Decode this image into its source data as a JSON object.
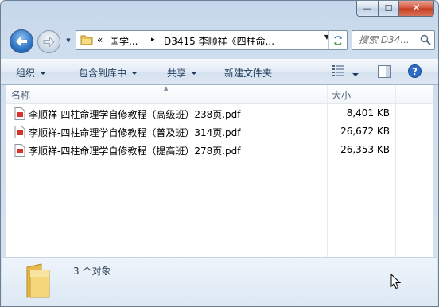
{
  "window": {
    "caption_buttons": {
      "minimize_glyph": "—",
      "maximize_glyph": "☐",
      "close_glyph": "✕"
    }
  },
  "nav": {
    "back_icon": "back-arrow-icon",
    "forward_icon": "forward-arrow-icon"
  },
  "address": {
    "overflow": "«",
    "segments": [
      "国学...",
      "D3415 李顺祥《四柱命..."
    ],
    "separator": "▸"
  },
  "search": {
    "placeholder": "搜索 D34..."
  },
  "toolbar": {
    "organize": "组织",
    "include_in_library": "包含到库中",
    "share": "共享",
    "new_folder": "新建文件夹"
  },
  "columns": {
    "name": "名称",
    "size": "大小"
  },
  "files": [
    {
      "name": "李顺祥-四柱命理学自修教程（高级班）238页.pdf",
      "size": "8,401 KB"
    },
    {
      "name": "李顺祥-四柱命理学自修教程（普及班）314页.pdf",
      "size": "26,672 KB"
    },
    {
      "name": "李顺祥-四柱命理学自修教程（提高班）278页.pdf",
      "size": "26,353 KB"
    }
  ],
  "details": {
    "count_text": "3 个对象"
  },
  "colors": {
    "accent": "#2f74c4",
    "close_red": "#c43d22",
    "folder_yellow": "#f2c94c",
    "pdf_red": "#d8322b"
  }
}
